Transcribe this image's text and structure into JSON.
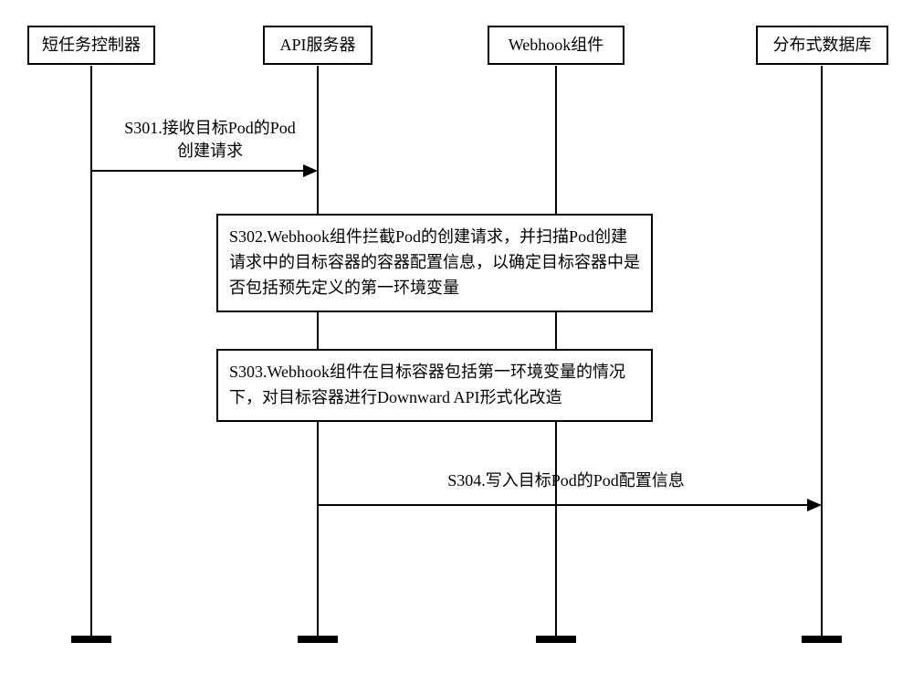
{
  "actors": {
    "a1": "短任务控制器",
    "a2": "API服务器",
    "a3": "Webhook组件",
    "a4": "分布式数据库"
  },
  "messages": {
    "m1": "S301.接收目标Pod的Pod\n创建请求",
    "m4": "S304.写入目标Pod的Pod配置信息"
  },
  "steps": {
    "s2": "S302.Webhook组件拦截Pod的创建请求，并扫描Pod创建请求中的目标容器的容器配置信息，以确定目标容器中是否包括预先定义的第一环境变量",
    "s3": "S303.Webhook组件在目标容器包括第一环境变量的情况下，对目标容器进行Downward API形式化改造"
  }
}
